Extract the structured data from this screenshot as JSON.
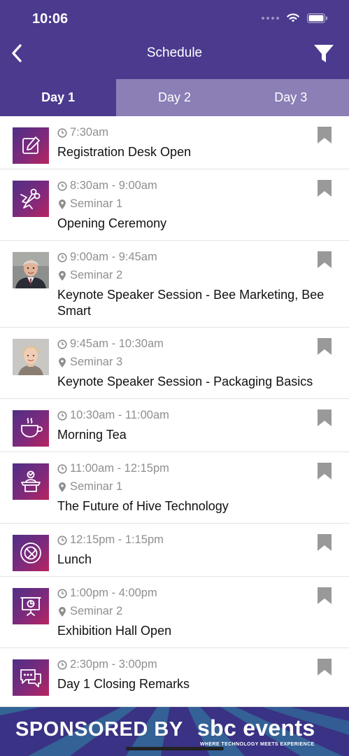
{
  "status_bar": {
    "time": "10:06",
    "signal_icon": "signal-dots-icon",
    "wifi_icon": "wifi-icon",
    "battery_icon": "battery-icon"
  },
  "header": {
    "title": "Schedule",
    "back_icon": "chevron-left-icon",
    "filter_icon": "filter-icon"
  },
  "colors": {
    "header": "#4b3a8e",
    "tab_inactive": "#8b7fb6",
    "icon_gradient": [
      "#4f2f86",
      "#b8245f"
    ],
    "meta_text": "#8f8f8f",
    "bookmark": "#999999"
  },
  "tabs": [
    {
      "label": "Day 1",
      "active": true
    },
    {
      "label": "Day 2",
      "active": false
    },
    {
      "label": "Day 3",
      "active": false
    }
  ],
  "sessions": [
    {
      "time": "7:30am",
      "location": "",
      "title": "Registration Desk Open",
      "thumb": "pencil-edit-icon"
    },
    {
      "time": "8:30am - 9:00am",
      "location": "Seminar 1",
      "title": "Opening Ceremony",
      "thumb": "ribbon-cutting-icon"
    },
    {
      "time": "9:00am - 9:45am",
      "location": "Seminar 2",
      "title": "Keynote Speaker Session - Bee Marketing, Bee Smart",
      "thumb": "speaker-photo-man"
    },
    {
      "time": "9:45am - 10:30am",
      "location": "Seminar 3",
      "title": "Keynote Speaker Session - Packaging Basics",
      "thumb": "speaker-photo-woman"
    },
    {
      "time": "10:30am - 11:00am",
      "location": "",
      "title": "Morning Tea",
      "thumb": "coffee-cup-icon"
    },
    {
      "time": "11:00am - 12:15pm",
      "location": "Seminar 1",
      "title": "The Future of Hive Technology",
      "thumb": "presenter-podium-icon"
    },
    {
      "time": "12:15pm - 1:15pm",
      "location": "",
      "title": "Lunch",
      "thumb": "plate-cutlery-icon"
    },
    {
      "time": "1:00pm - 4:00pm",
      "location": "Seminar 2",
      "title": "Exhibition Hall Open",
      "thumb": "presentation-board-icon"
    },
    {
      "time": "2:30pm - 3:00pm",
      "location": "",
      "title": "Day 1 Closing Remarks",
      "thumb": "chat-bubbles-icon"
    }
  ],
  "banner": {
    "sponsor_text": "SPONSORED BY",
    "brand": "sbc events",
    "tagline": "WHERE TECHNOLOGY MEETS EXPERIENCE"
  }
}
